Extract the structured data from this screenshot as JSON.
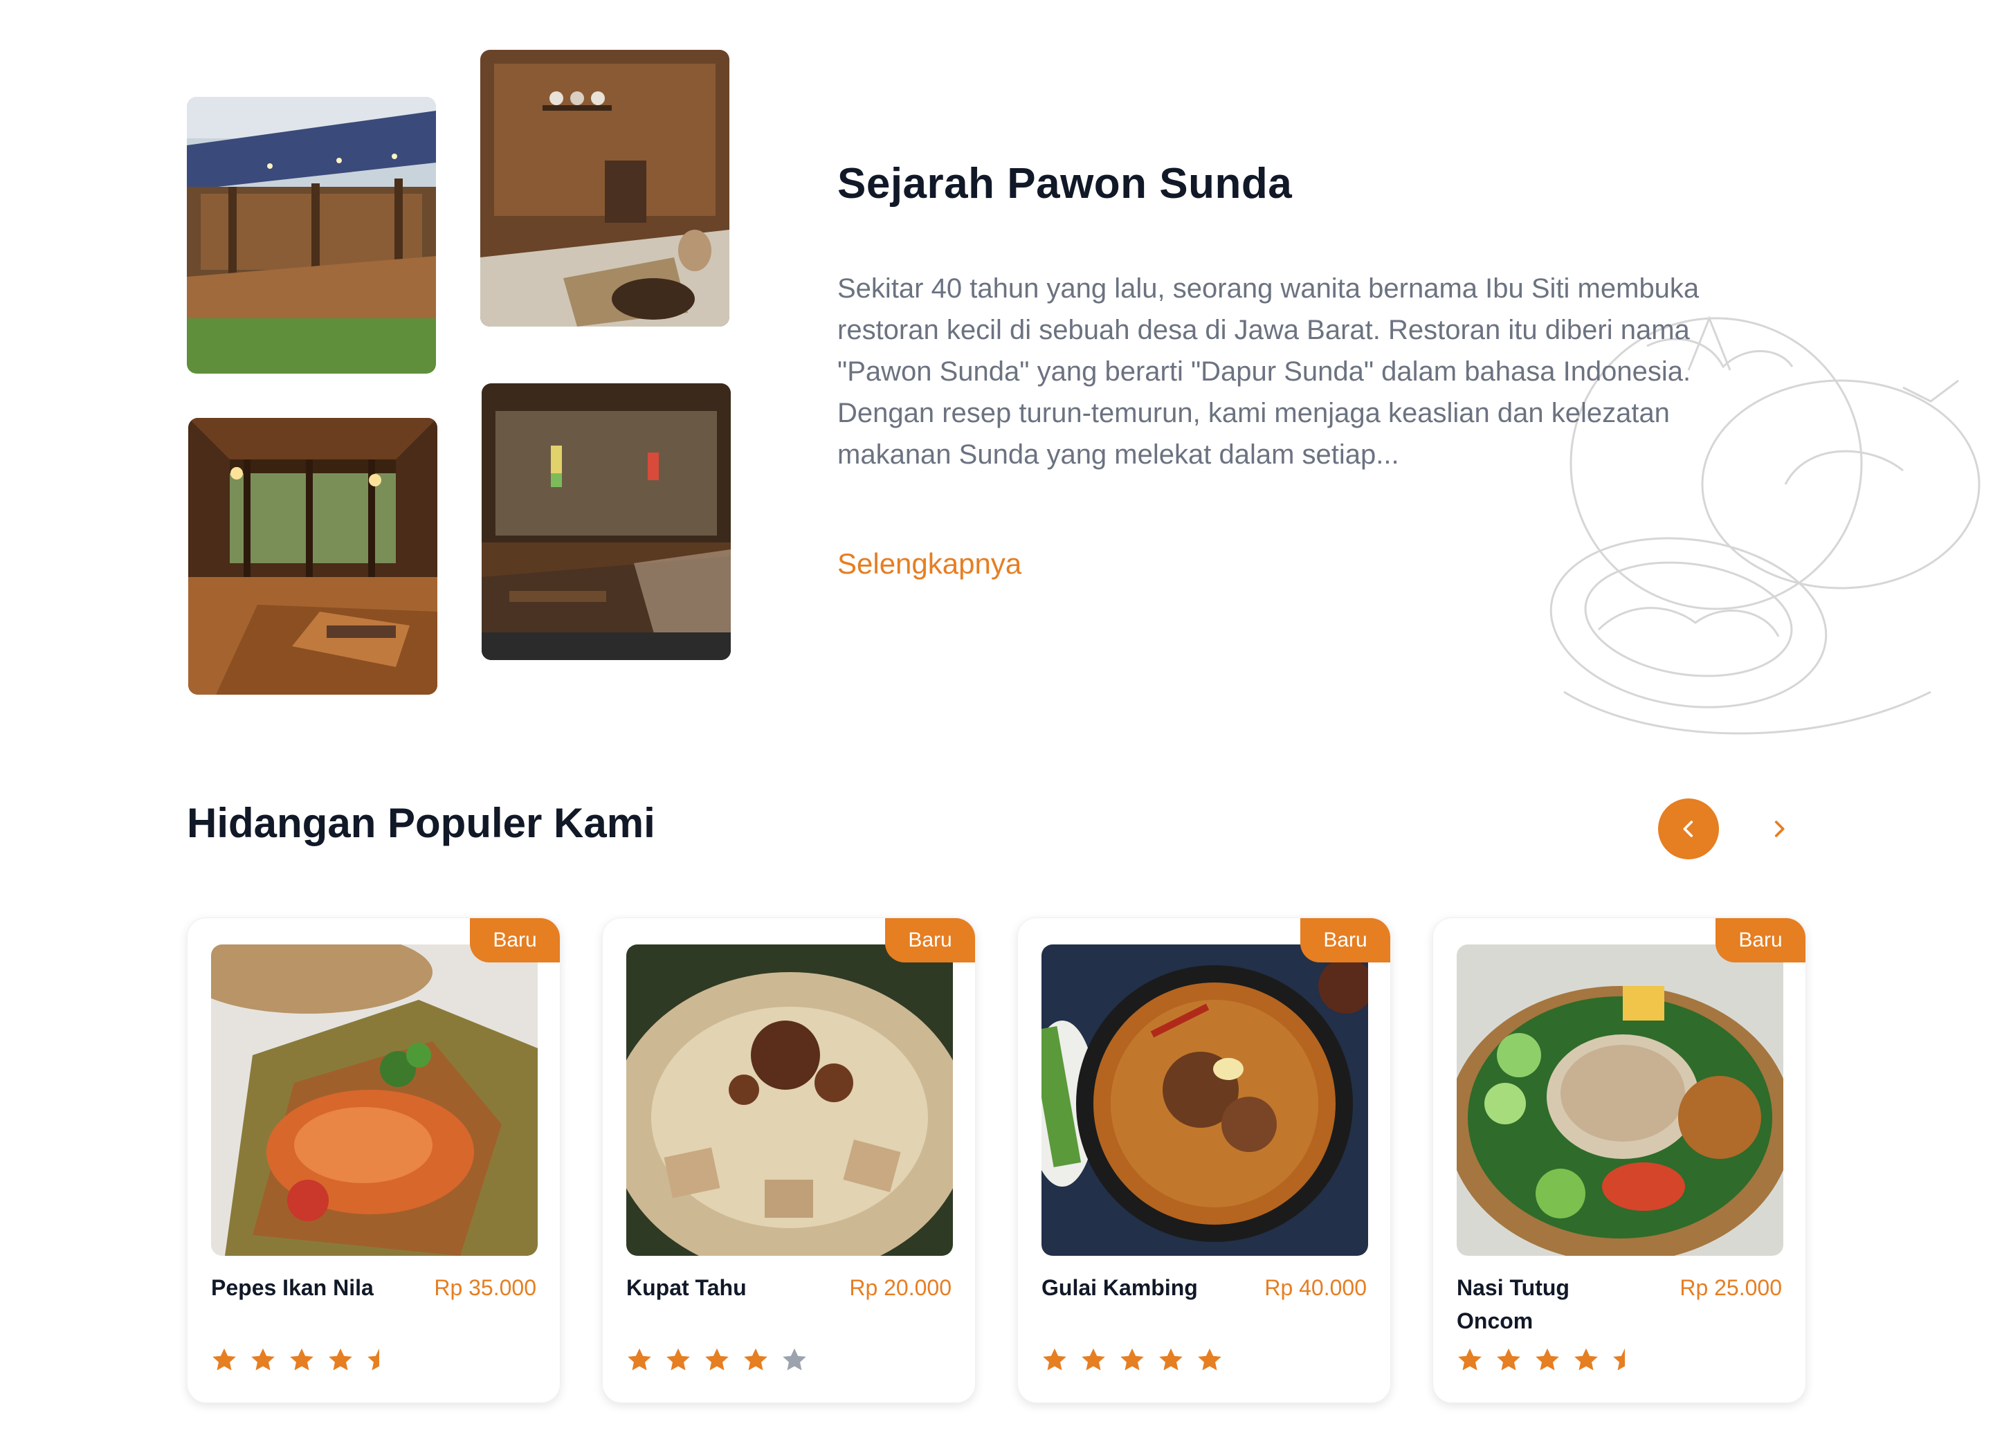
{
  "about": {
    "title": "Sejarah Pawon Sunda",
    "description": "Sekitar 40 tahun yang lalu, seorang wanita bernama Ibu Siti membuka restoran kecil di sebuah desa di Jawa Barat. Restoran itu diberi nama \"Pawon Sunda\" yang berarti \"Dapur Sunda\" dalam bahasa Indonesia. Dengan resep turun-temurun, kami menjaga keaslian dan kelezatan makanan Sunda yang melekat dalam setiap...",
    "link_label": "Selengkapnya"
  },
  "popular": {
    "title": "Hidangan Populer Kami",
    "prev_icon": "chevron-left-icon",
    "next_icon": "chevron-right-icon",
    "items": [
      {
        "badge": "Baru",
        "name": "Pepes Ikan Nila",
        "price": "Rp 35.000",
        "rating": 4.5
      },
      {
        "badge": "Baru",
        "name": "Kupat Tahu",
        "price": "Rp 20.000",
        "rating": 4
      },
      {
        "badge": "Baru",
        "name": "Gulai Kambing",
        "price": "Rp 40.000",
        "rating": 5
      },
      {
        "badge": "Baru",
        "name": "Nasi Tutug Oncom",
        "price": "Rp 25.000",
        "rating": 4.5
      }
    ]
  },
  "colors": {
    "accent": "#e67e22",
    "text": "#111827",
    "muted": "#6b7280",
    "star_empty": "#9ca3af"
  }
}
